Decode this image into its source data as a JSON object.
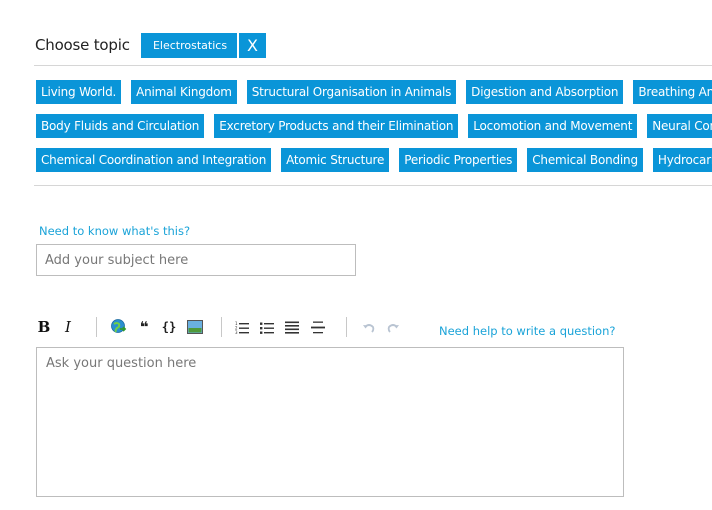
{
  "choose_topic": {
    "label": "Choose topic",
    "selected": "Electrostatics",
    "remove_glyph": "X"
  },
  "topics": {
    "row1": [
      "Living World.",
      "Animal Kingdom",
      "Structural Organisation in Animals",
      "Digestion and Absorption",
      "Breathing And Exchange of Gases"
    ],
    "row2": [
      "Body Fluids and Circulation",
      "Excretory Products and their Elimination",
      "Locomotion and Movement",
      "Neural Control and Coordination"
    ],
    "row3": [
      "Chemical Coordination and Integration",
      "Atomic Structure",
      "Periodic Properties",
      "Chemical Bonding",
      "Hydrocarbons"
    ]
  },
  "subject": {
    "help_link": "Need to know what's this?",
    "placeholder": "Add your subject here"
  },
  "editor": {
    "toolbar": {
      "bold": "B",
      "italic": "I",
      "link": "link-icon",
      "quote": "❝",
      "code": "{}",
      "image": "image-icon",
      "ordered_list": "ordered-list-icon",
      "unordered_list": "unordered-list-icon",
      "heading": "heading-icon",
      "horizontal_rule": "horizontal-rule-icon",
      "undo": "undo-icon",
      "redo": "redo-icon"
    },
    "help_link": "Need help to write a question?",
    "placeholder": "Ask your question here"
  },
  "colors": {
    "accent": "#0a95d8",
    "link": "#1aa3d8"
  }
}
